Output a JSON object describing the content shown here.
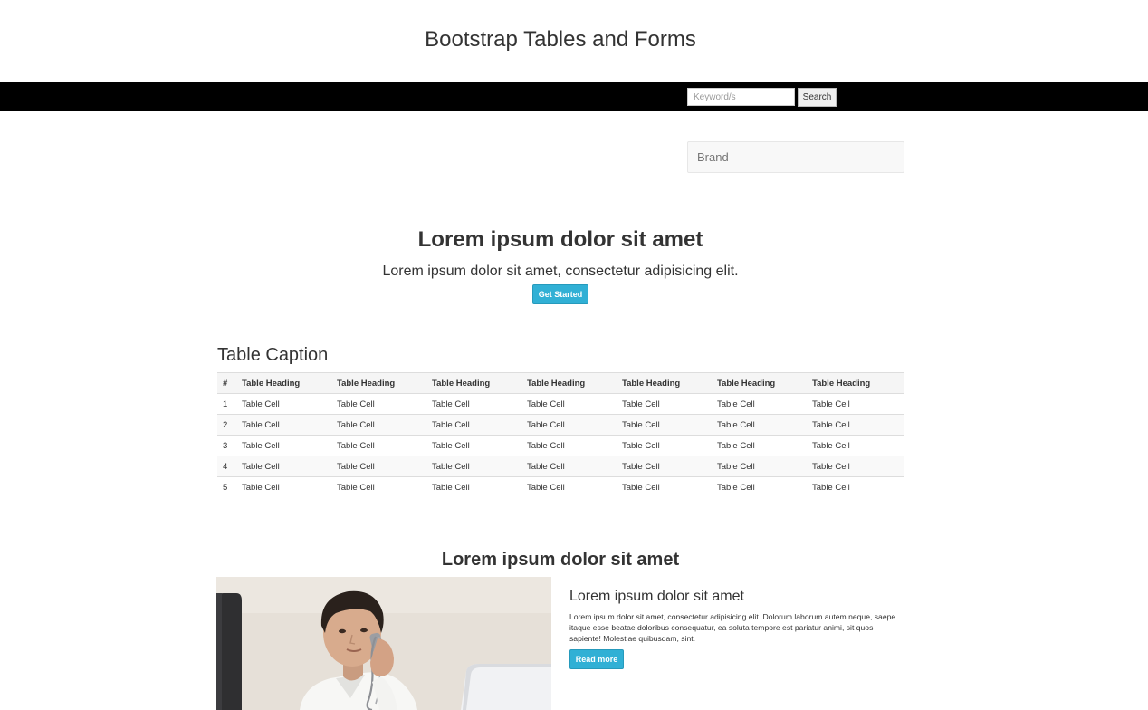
{
  "header": {
    "title": "Bootstrap Tables and Forms"
  },
  "navbar": {
    "search_placeholder": "Keyword/s",
    "search_button": "Search"
  },
  "brand": {
    "label": "Brand"
  },
  "hero": {
    "heading": "Lorem ipsum dolor sit amet",
    "subheading": "Lorem ipsum dolor sit amet, consectetur adipisicing elit.",
    "button": "Get Started"
  },
  "table": {
    "caption": "Table Caption",
    "headers": [
      "#",
      "Table Heading",
      "Table Heading",
      "Table Heading",
      "Table Heading",
      "Table Heading",
      "Table Heading",
      "Table Heading"
    ],
    "rows": [
      [
        "1",
        "Table Cell",
        "Table Cell",
        "Table Cell",
        "Table Cell",
        "Table Cell",
        "Table Cell",
        "Table Cell"
      ],
      [
        "2",
        "Table Cell",
        "Table Cell",
        "Table Cell",
        "Table Cell",
        "Table Cell",
        "Table Cell",
        "Table Cell"
      ],
      [
        "3",
        "Table Cell",
        "Table Cell",
        "Table Cell",
        "Table Cell",
        "Table Cell",
        "Table Cell",
        "Table Cell"
      ],
      [
        "4",
        "Table Cell",
        "Table Cell",
        "Table Cell",
        "Table Cell",
        "Table Cell",
        "Table Cell",
        "Table Cell"
      ],
      [
        "5",
        "Table Cell",
        "Table Cell",
        "Table Cell",
        "Table Cell",
        "Table Cell",
        "Table Cell",
        "Table Cell"
      ]
    ]
  },
  "feature": {
    "section_heading": "Lorem ipsum dolor sit amet",
    "title": "Lorem ipsum dolor sit amet",
    "text": "Lorem ipsum dolor sit amet, consectetur adipisicing elit. Dolorum laborum autem neque, saepe itaque esse beatae doloribus consequatur, ea soluta tempore est pariatur animi, sit quos sapiente! Molestiae quibusdam, sint.",
    "button": "Read more"
  },
  "colors": {
    "accent": "#31b0d5",
    "navbar": "#000000"
  }
}
